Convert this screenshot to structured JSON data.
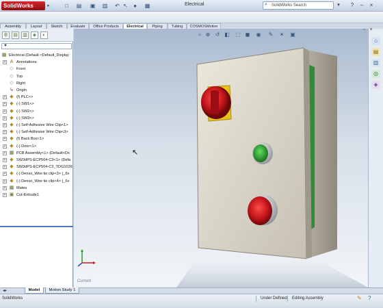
{
  "app": {
    "logo_text": "SolidWorks",
    "window_title": "Electrical",
    "search_placeholder": "SolidWorks Search"
  },
  "command_tabs": [
    "Assembly",
    "Layout",
    "Sketch",
    "Evaluate",
    "Office Products",
    "Electrical",
    "Piping",
    "Tubing",
    "COSMOSMotion"
  ],
  "active_command_tab": "Electrical",
  "feature_tree": {
    "root": "Electrical  (Default <Default_Display",
    "items": [
      "Annotations",
      "Front",
      "Top",
      "Right",
      "Origin",
      "(f) PLC<>",
      "(-) SW1<>",
      "(-) SW2<>",
      "(-) SW3<>",
      "(-) Self-Adhesive Wire Clip<1>",
      "(-) Self-Adhesive Wire Clip<3>",
      "(f) Back Box<1>",
      "(-) Door<1>",
      "PCB Assembly<1> (Default<Dx",
      "SW3dPS-ECP504-C3<1> (Defa",
      "SW3dPS-ECP504-C3_TDG1026",
      "(-) Denso_Wire tie clip<3> (_6x",
      "(-) Denso_Wire tie clip<4> (_6x",
      "Mates",
      "Cut-Extrude1"
    ]
  },
  "bottom_tabs": {
    "model": "Model",
    "motion_study": "Motion Study 1"
  },
  "status": {
    "app_name": "SolidWorks",
    "definition": "Under Defined",
    "mode": "Editing Assembly"
  },
  "graphics": {
    "view_label": "Current"
  },
  "colors": {
    "titlebar": "#dbe4ef",
    "graphics_top": "#a9bacf",
    "graphics_bottom": "#f2f5f9",
    "enclosure": "#d8d3c6",
    "red_button": "#c5171b",
    "yellow_bezel": "#e8c21c",
    "green_button": "#2b9a2c",
    "tree_separator": "#4a79b7"
  }
}
